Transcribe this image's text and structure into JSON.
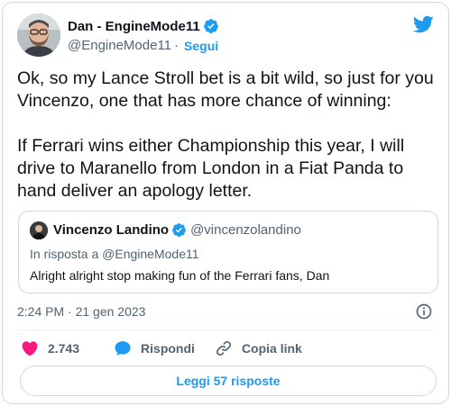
{
  "author": {
    "display_name": "Dan - EngineMode11",
    "handle": "@EngineMode11",
    "separator": "·",
    "follow_label": "Segui"
  },
  "tweet": {
    "text": "Ok, so my Lance Stroll bet is a bit wild, so just for you Vincenzo, one that has more chance of winning:\n\nIf Ferrari wins either Championship this year, I will drive to Maranello from London in a Fiat Panda to hand deliver an apology letter."
  },
  "quote": {
    "display_name": "Vincenzo Landino",
    "handle": "@vincenzolandino",
    "reply_to": "In risposta a @EngineMode11",
    "text": "Alright alright stop making fun of the Ferrari fans, Dan"
  },
  "timestamp": "2:24 PM · 21 gen 2023",
  "actions": {
    "like_count": "2.743",
    "reply_label": "Rispondi",
    "copy_link_label": "Copia link"
  },
  "read_replies_label": "Leggi 57 risposte",
  "colors": {
    "accent": "#1d9bf0",
    "like": "#f91880",
    "text": "#0f1419",
    "secondary": "#536471",
    "border": "#cfd9de"
  },
  "icons": [
    "verified-badge-icon",
    "twitter-bird-icon",
    "info-icon",
    "heart-icon",
    "reply-bubble-icon",
    "link-icon"
  ]
}
